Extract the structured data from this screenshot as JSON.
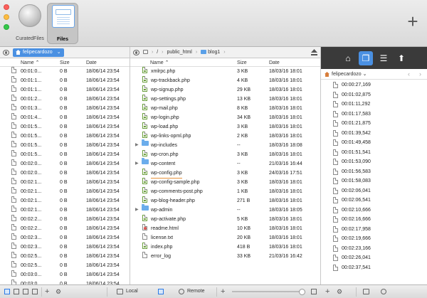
{
  "toolbar": {
    "tools": [
      {
        "label": "CuratedFiles",
        "selected": false
      },
      {
        "label": "Files",
        "selected": true
      }
    ],
    "add_symbol": "+"
  },
  "local": {
    "location": "felipecardozo",
    "columns": {
      "name": "Name",
      "size": "Size",
      "date": "Date"
    },
    "rows": [
      {
        "name": "00:01:0...",
        "size": "0 B",
        "date": "18/06/14 23:54"
      },
      {
        "name": "00:01:1...",
        "size": "0 B",
        "date": "18/06/14 23:54"
      },
      {
        "name": "00:01:1...",
        "size": "0 B",
        "date": "18/06/14 23:54"
      },
      {
        "name": "00:01:2...",
        "size": "0 B",
        "date": "18/06/14 23:54"
      },
      {
        "name": "00:01:3...",
        "size": "0 B",
        "date": "18/06/14 23:54"
      },
      {
        "name": "00:01:4...",
        "size": "0 B",
        "date": "18/06/14 23:54"
      },
      {
        "name": "00:01:5...",
        "size": "0 B",
        "date": "18/06/14 23:54"
      },
      {
        "name": "00:01:5...",
        "size": "0 B",
        "date": "18/06/14 23:54"
      },
      {
        "name": "00:01:5...",
        "size": "0 B",
        "date": "18/06/14 23:54"
      },
      {
        "name": "00:01:5...",
        "size": "0 B",
        "date": "18/06/14 23:54"
      },
      {
        "name": "00:02:0...",
        "size": "0 B",
        "date": "18/06/14 23:54"
      },
      {
        "name": "00:02:0...",
        "size": "0 B",
        "date": "18/06/14 23:54"
      },
      {
        "name": "00:02:1...",
        "size": "0 B",
        "date": "18/06/14 23:54"
      },
      {
        "name": "00:02:1...",
        "size": "0 B",
        "date": "18/06/14 23:54"
      },
      {
        "name": "00:02:1...",
        "size": "0 B",
        "date": "18/06/14 23:54"
      },
      {
        "name": "00:02:1...",
        "size": "0 B",
        "date": "18/06/14 23:54"
      },
      {
        "name": "00:02:2...",
        "size": "0 B",
        "date": "18/06/14 23:54"
      },
      {
        "name": "00:02:2...",
        "size": "0 B",
        "date": "18/06/14 23:54"
      },
      {
        "name": "00:02:3...",
        "size": "0 B",
        "date": "18/06/14 23:54"
      },
      {
        "name": "00:02:3...",
        "size": "0 B",
        "date": "18/06/14 23:54"
      },
      {
        "name": "00:02:5...",
        "size": "0 B",
        "date": "18/06/14 23:54"
      },
      {
        "name": "00:02:5...",
        "size": "0 B",
        "date": "18/06/14 23:54"
      },
      {
        "name": "00:03:0...",
        "size": "0 B",
        "date": "18/06/14 23:54"
      },
      {
        "name": "00:03:0...",
        "size": "0 B",
        "date": "18/06/14 23:54"
      }
    ]
  },
  "remote": {
    "crumbs": [
      "/",
      "public_html",
      "blog1"
    ],
    "columns": {
      "name": "Name",
      "size": "Size",
      "date": "Date"
    },
    "rows": [
      {
        "name": "xmlrpc.php",
        "size": "3 KB",
        "date": "18/03/16 18:01",
        "type": "php"
      },
      {
        "name": "wp-trackback.php",
        "size": "4 KB",
        "date": "18/03/16 18:01",
        "type": "php"
      },
      {
        "name": "wp-signup.php",
        "size": "29 KB",
        "date": "18/03/16 18:01",
        "type": "php"
      },
      {
        "name": "wp-settings.php",
        "size": "13 KB",
        "date": "18/03/16 18:01",
        "type": "php"
      },
      {
        "name": "wp-mail.php",
        "size": "8 KB",
        "date": "18/03/16 18:01",
        "type": "php"
      },
      {
        "name": "wp-login.php",
        "size": "34 KB",
        "date": "18/03/16 18:01",
        "type": "php"
      },
      {
        "name": "wp-load.php",
        "size": "3 KB",
        "date": "18/03/16 18:01",
        "type": "php"
      },
      {
        "name": "wp-links-opml.php",
        "size": "2 KB",
        "date": "18/03/16 18:01",
        "type": "php"
      },
      {
        "name": "wp-includes",
        "size": "--",
        "date": "18/03/16 18:08",
        "type": "folder"
      },
      {
        "name": "wp-cron.php",
        "size": "3 KB",
        "date": "18/03/16 18:01",
        "type": "php"
      },
      {
        "name": "wp-content",
        "size": "--",
        "date": "21/03/16 16:44",
        "type": "folder"
      },
      {
        "name": "wp-config.php",
        "size": "3 KB",
        "date": "24/03/16 17:51",
        "type": "php"
      },
      {
        "name": "wp-config-sample.php",
        "size": "3 KB",
        "date": "18/03/16 18:01",
        "type": "php"
      },
      {
        "name": "wp-comments-post.php",
        "size": "1 KB",
        "date": "18/03/16 18:01",
        "type": "php"
      },
      {
        "name": "wp-blog-header.php",
        "size": "271 B",
        "date": "18/03/16 18:01",
        "type": "php"
      },
      {
        "name": "wp-admin",
        "size": "--",
        "date": "18/03/16 18:05",
        "type": "folder"
      },
      {
        "name": "wp-activate.php",
        "size": "5 KB",
        "date": "18/03/16 18:01",
        "type": "php"
      },
      {
        "name": "readme.html",
        "size": "10 KB",
        "date": "18/03/16 18:01",
        "type": "html"
      },
      {
        "name": "license.txt",
        "size": "20 KB",
        "date": "18/03/16 18:01",
        "type": "txt"
      },
      {
        "name": "index.php",
        "size": "418 B",
        "date": "18/03/16 18:01",
        "type": "php"
      },
      {
        "name": "error_log",
        "size": "33 KB",
        "date": "21/03/16 16:42",
        "type": "txt"
      }
    ]
  },
  "preview": {
    "location": "felipecardozo",
    "items": [
      "00:00:27,169",
      "00:01:02,875",
      "00:01:11,292",
      "00:01:17,583",
      "00:01:21,875",
      "00:01:39,542",
      "00:01:49,458",
      "00:01:51,541",
      "00:01:53,090",
      "00:01:56,583",
      "00:01:58,083",
      "00:02:06,041",
      "00:02:06,541",
      "00:02:10,666",
      "00:02:16,666",
      "00:02:17,958",
      "00:02:19,666",
      "00:02:23,166",
      "00:02:26,041",
      "00:02:37,541"
    ]
  },
  "bottom": {
    "local_label": "Local",
    "remote_label": "Remote"
  }
}
